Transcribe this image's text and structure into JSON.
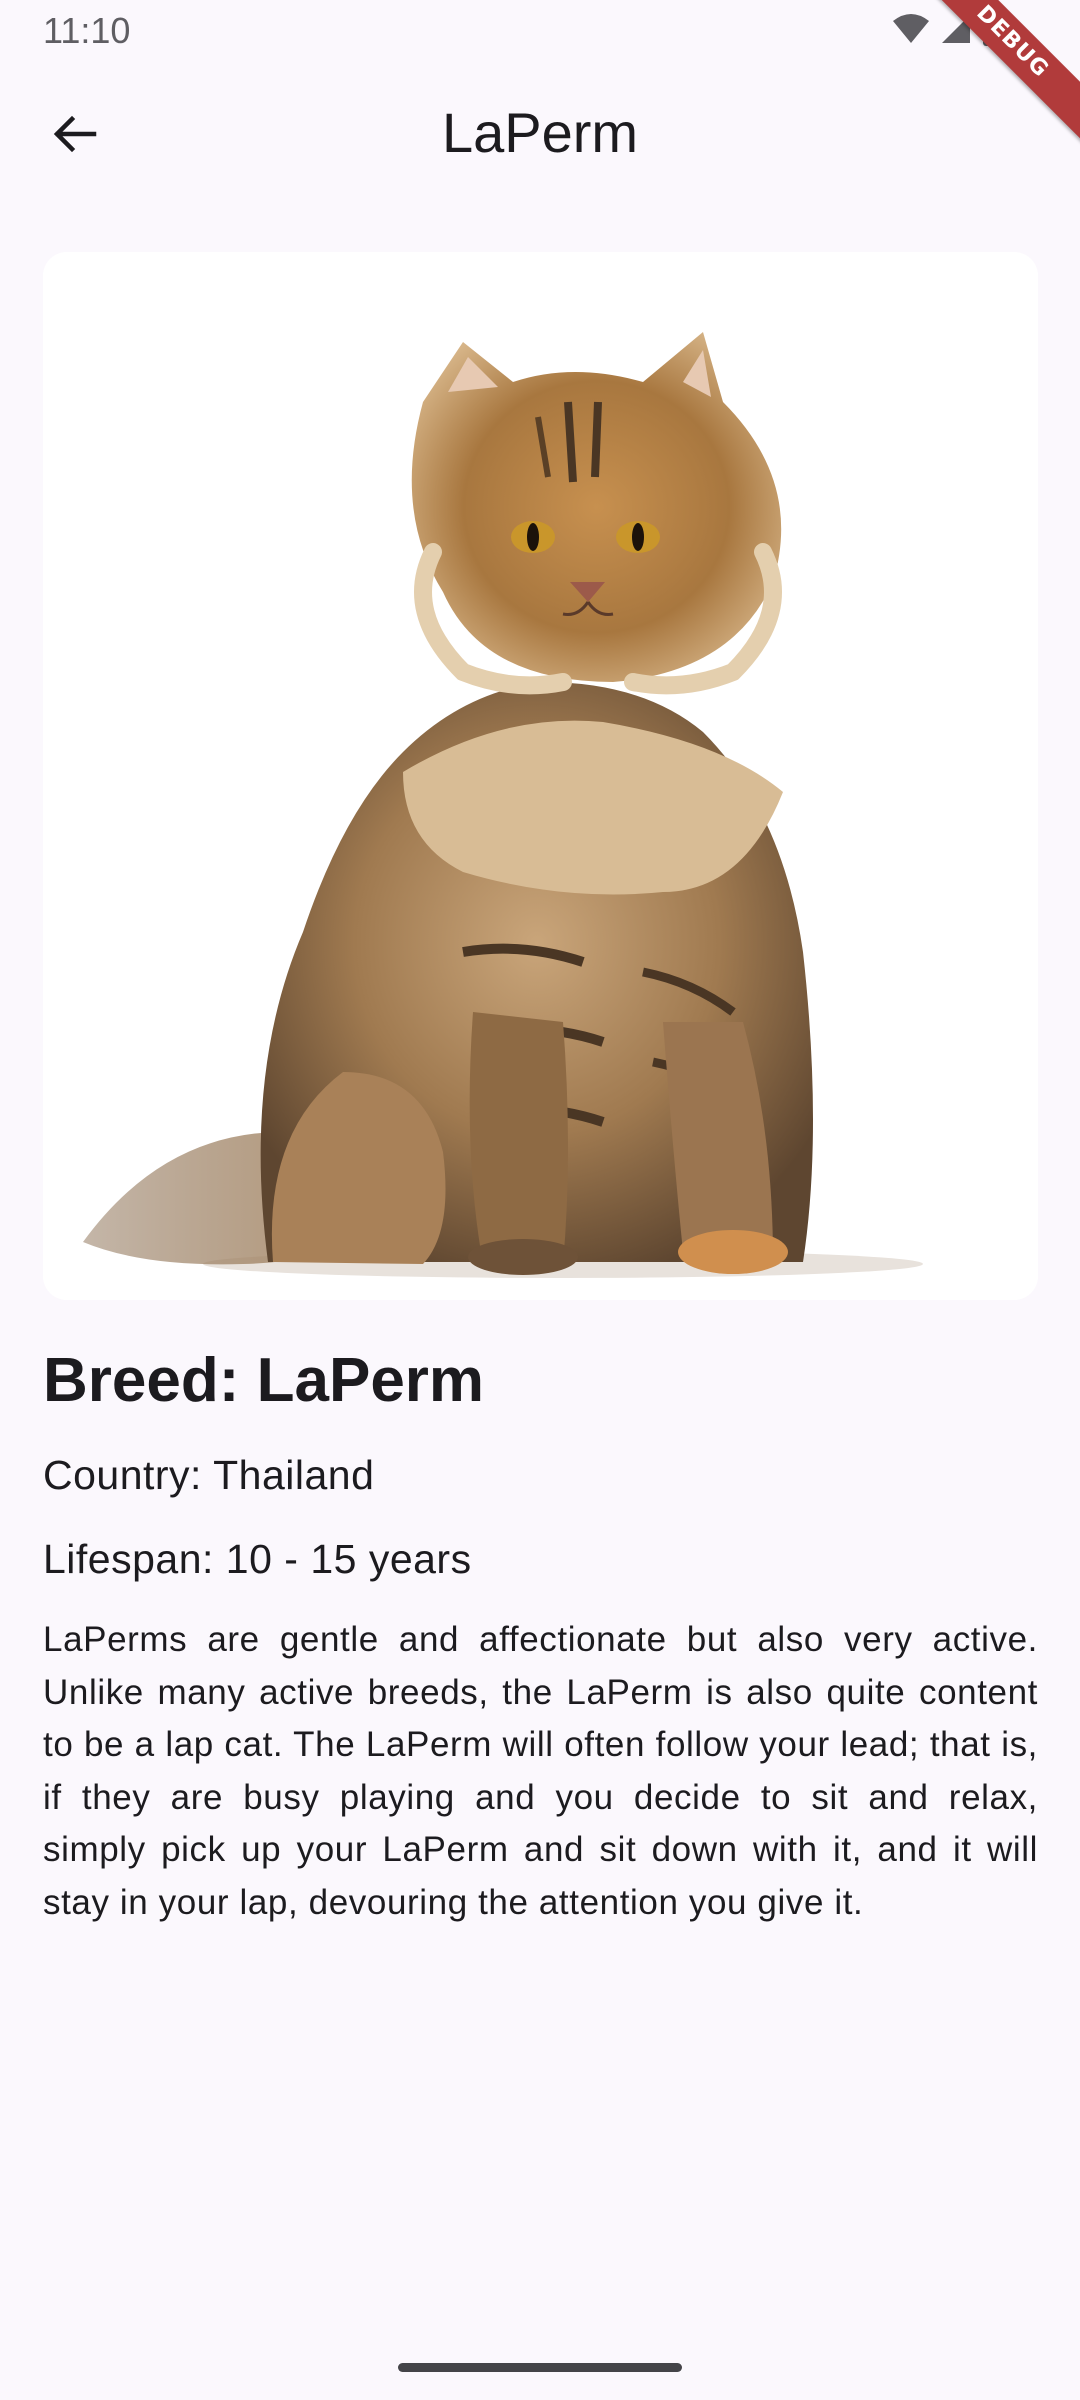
{
  "status_bar": {
    "time": "11:10",
    "icons": [
      "wifi-icon",
      "cellular-signal-icon",
      "battery-icon"
    ]
  },
  "debug_banner": {
    "label": "DEBUG",
    "color": "#b13b3b"
  },
  "app_bar": {
    "back_icon": "arrow-back-icon",
    "title": "LaPerm"
  },
  "breed_image": {
    "subject": "fluffy-tabby-cat-photo"
  },
  "details": {
    "breed_heading": "Breed: LaPerm",
    "country": "Country: Thailand",
    "lifespan": "Lifespan: 10 - 15 years",
    "description": "LaPerms are gentle and affectionate but also very active. Unlike many active breeds, the LaPerm is also quite content to be a lap cat. The LaPerm will often follow your lead; that is, if they are busy playing and you decide to sit and relax, simply pick up your LaPerm and sit down with it, and it will stay in your lap, devouring the attention you give it."
  },
  "colors": {
    "background": "#fbf8fd",
    "text": "#1c1b1f",
    "card": "#ffffff"
  }
}
